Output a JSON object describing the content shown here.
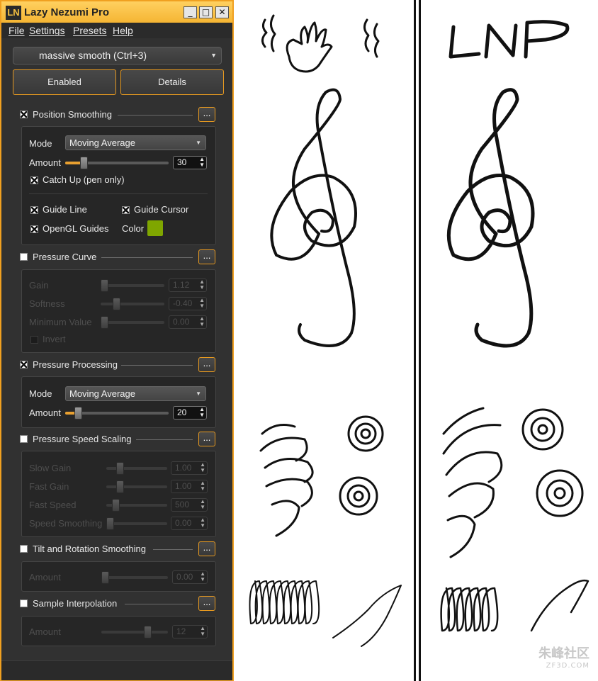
{
  "window": {
    "icon": "LN",
    "title": "Lazy Nezumi Pro",
    "minimize": "_",
    "maximize": "□",
    "close": "✕"
  },
  "menu": [
    "File",
    "Settings",
    "Presets",
    "Help"
  ],
  "preset": "massive smooth (Ctrl+3)",
  "buttons": {
    "enabled": "Enabled",
    "details": "Details"
  },
  "dots": "...",
  "position_smoothing": {
    "label": "Position Smoothing",
    "checked": true,
    "mode_label": "Mode",
    "mode_value": "Moving Average",
    "amount_label": "Amount",
    "amount_value": "30",
    "amount_fraction": 0.18,
    "catch_up": "Catch Up (pen only)",
    "guide_line": "Guide Line",
    "guide_cursor": "Guide Cursor",
    "opengl_guides": "OpenGL Guides",
    "color_label": "Color",
    "color": "#7fa600"
  },
  "pressure_curve": {
    "label": "Pressure Curve",
    "checked": false,
    "gain_label": "Gain",
    "gain_value": "1.12",
    "softness_label": "Softness",
    "softness_value": "-0.40",
    "minimum_label": "Minimum Value",
    "minimum_value": "0.00",
    "invert": "Invert"
  },
  "pressure_processing": {
    "label": "Pressure Processing",
    "checked": true,
    "mode_label": "Mode",
    "mode_value": "Moving Average",
    "amount_label": "Amount",
    "amount_value": "20",
    "amount_fraction": 0.12
  },
  "pressure_speed": {
    "label": "Pressure Speed Scaling",
    "checked": false,
    "slow_gain_label": "Slow Gain",
    "slow_gain_value": "1.00",
    "fast_gain_label": "Fast Gain",
    "fast_gain_value": "1.00",
    "fast_speed_label": "Fast Speed",
    "fast_speed_value": "500",
    "speed_smoothing_label": "Speed Smoothing",
    "speed_smoothing_value": "0.00"
  },
  "tilt_rotation": {
    "label": "Tilt and Rotation Smoothing",
    "checked": false,
    "amount_label": "Amount",
    "amount_value": "0.00"
  },
  "sample_interpolation": {
    "label": "Sample Interpolation",
    "checked": false,
    "amount_label": "Amount",
    "amount_value": "12"
  },
  "drawings": {
    "left_top": "hand-icon",
    "right_top": "LNP",
    "watermark_main": "朱峰社区",
    "watermark_sub": "ZF3D.COM"
  }
}
